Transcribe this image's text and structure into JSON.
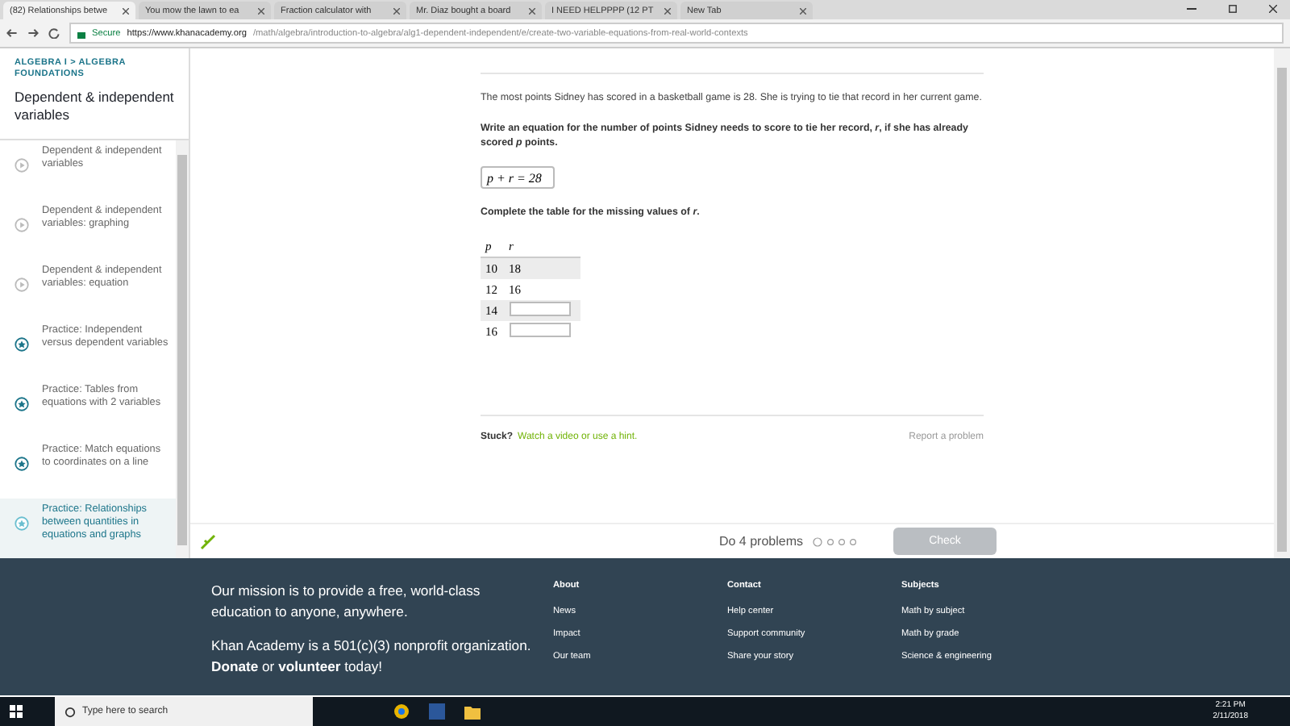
{
  "browser": {
    "tabs": [
      {
        "title": "(82) Relationships betwe",
        "selected": true
      },
      {
        "title": "You mow the lawn to ea",
        "selected": false
      },
      {
        "title": "Fraction calculator with",
        "selected": false
      },
      {
        "title": "Mr. Diaz bought a board",
        "selected": false
      },
      {
        "title": "I NEED HELPPPP (12 PT",
        "selected": false
      },
      {
        "title": "New Tab",
        "selected": false
      }
    ],
    "secure_label": "Secure",
    "url_host": "https://www.khanacademy.org",
    "url_path": "/math/algebra/introduction-to-algebra/alg1-dependent-independent/e/create-two-variable-equations-from-real-world-contexts"
  },
  "sidebar": {
    "breadcrumb": [
      "ALGEBRA I",
      "ALGEBRA FOUNDATIONS"
    ],
    "breadcrumb_separator": ">",
    "title": "Dependent & independent variables",
    "items": [
      {
        "label": "Dependent & independent variables",
        "kind": "video",
        "selected": false
      },
      {
        "label": "Dependent & independent variables: graphing",
        "kind": "video",
        "selected": false
      },
      {
        "label": "Dependent & independent variables: equation",
        "kind": "video",
        "selected": false
      },
      {
        "label": "Practice: Independent versus dependent variables",
        "kind": "practice",
        "selected": false
      },
      {
        "label": "Practice: Tables from equations with 2 variables",
        "kind": "practice",
        "selected": false
      },
      {
        "label": "Practice: Match equations to coordinates on a line",
        "kind": "practice",
        "selected": false
      },
      {
        "label": "Practice: Relationships between quantities in equations and graphs",
        "kind": "practice",
        "selected": true
      }
    ]
  },
  "exercise": {
    "problem": "The most points Sidney has scored in a basketball game is 28. She is trying to tie that record in her current game.",
    "question": "Write an equation for the number of points Sidney needs to score to tie her record, *r*, if she has already scored *p* points.",
    "answer": "p + r = 28",
    "table_prompt": "Complete the table for the missing values of *r*.",
    "table": {
      "columns": [
        "p",
        "r"
      ],
      "rows": [
        {
          "p": "10",
          "r": "18",
          "kind": "value"
        },
        {
          "p": "12",
          "r": "16",
          "kind": "value"
        },
        {
          "p": "14",
          "kind": "input"
        },
        {
          "p": "16",
          "kind": "input"
        }
      ]
    },
    "stuck": "Stuck?",
    "hint_link": "Watch a video or use a hint.",
    "report_link": "Report a problem",
    "goal": "Do 4 problems",
    "check_button": {
      "label": "Check",
      "disabled": true
    }
  },
  "footer": {
    "mission": "Our mission is to provide a free, world-class education to anyone, anywhere.",
    "nonprofit": "Khan Academy is a 501(c)(3) nonprofit organization. **Donate** or **volunteer** today!",
    "columns": [
      {
        "heading": "About",
        "links": [
          "News",
          "Impact",
          "Our team"
        ]
      },
      {
        "heading": "Contact",
        "links": [
          "Help center",
          "Support community",
          "Share your story"
        ]
      },
      {
        "heading": "Subjects",
        "links": [
          "Math by subject",
          "Math by grade",
          "Science & engineering"
        ]
      }
    ]
  },
  "taskbar": {
    "search_placeholder": "Type here to search",
    "time": "2:21 PM",
    "date": "2/11/2018"
  }
}
